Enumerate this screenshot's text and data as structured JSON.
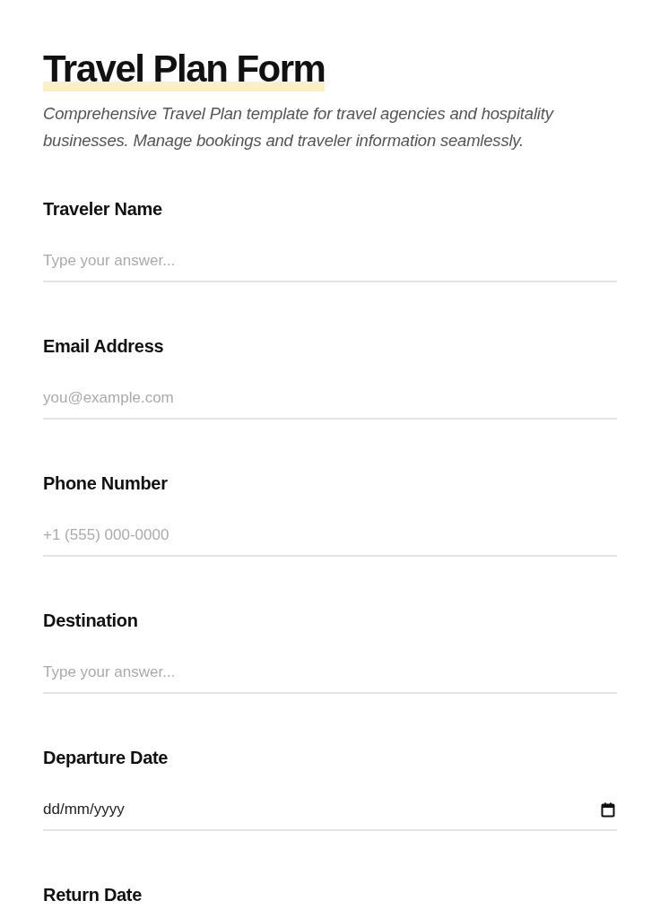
{
  "title": "Travel Plan Form",
  "description": "Comprehensive Travel Plan template for travel agencies and hospitality businesses. Manage bookings and traveler information seamlessly.",
  "fields": [
    {
      "kind": "text",
      "label": "Traveler Name",
      "placeholder": "Type your answer..."
    },
    {
      "kind": "text",
      "label": "Email Address",
      "placeholder": "you@example.com"
    },
    {
      "kind": "text",
      "label": "Phone Number",
      "placeholder": "+1 (555) 000-0000"
    },
    {
      "kind": "text",
      "label": "Destination",
      "placeholder": "Type your answer..."
    },
    {
      "kind": "date",
      "label": "Departure Date",
      "placeholder": "dd/mm/yyyy"
    },
    {
      "kind": "label",
      "label": "Return Date"
    }
  ]
}
